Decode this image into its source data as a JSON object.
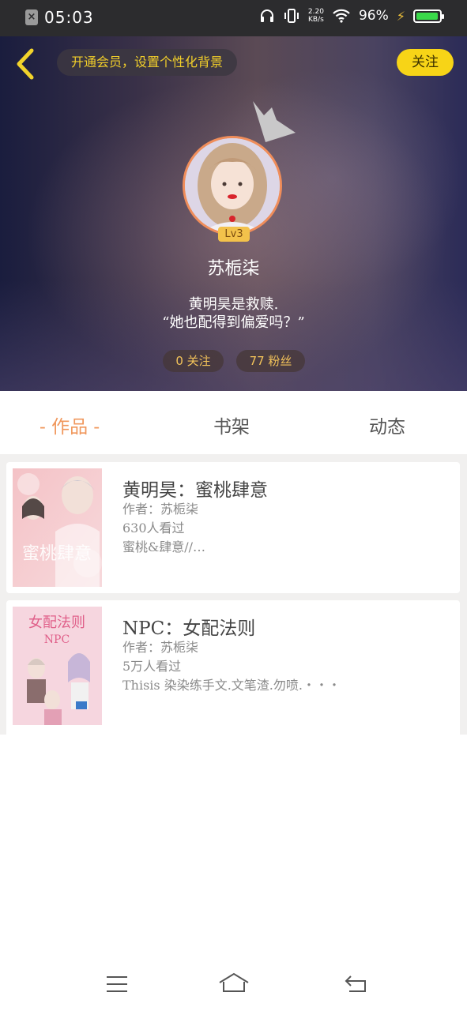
{
  "status_bar": {
    "time": "05:03",
    "net_speed_value": "2.20",
    "net_speed_unit": "KB/s",
    "battery": "96%",
    "battery_level": 0.96,
    "icons": [
      "close-notification-icon",
      "headphones-icon",
      "vibrate-icon",
      "wifi-icon",
      "charging-icon",
      "battery-icon"
    ]
  },
  "header": {
    "vip_prompt": "开通会员，设置个性化背景",
    "follow_label": "关注",
    "level": "Lv3",
    "username": "苏栀柒",
    "bio_line1": "黄明昊是救赎.",
    "bio_line2": "“她也配得到偏爱吗？”",
    "following": "0 关注",
    "fans": "77 粉丝"
  },
  "tabs": [
    {
      "label": "- 作品 -",
      "active": true
    },
    {
      "label": "书架",
      "active": false
    },
    {
      "label": "动态",
      "active": false
    }
  ],
  "works": [
    {
      "title": "黄明昊：蜜桃肆意",
      "author": "作者：苏栀柒",
      "views": "630人看过",
      "summary": "蜜桃&肆意//…",
      "cover_text": "蜜桃肆意"
    },
    {
      "title": "NPC：女配法则",
      "author": "作者：苏栀柒",
      "views": "5万人看过",
      "summary": "Thisis 染染练手文.文笔渣.勿喷.・・・",
      "cover_text_top": "女配法则",
      "cover_text_mid": "NPC"
    }
  ],
  "colors": {
    "accent_orange": "#f0975c",
    "follow_yellow": "#f7d417",
    "stat_gold": "#f3c35a"
  }
}
